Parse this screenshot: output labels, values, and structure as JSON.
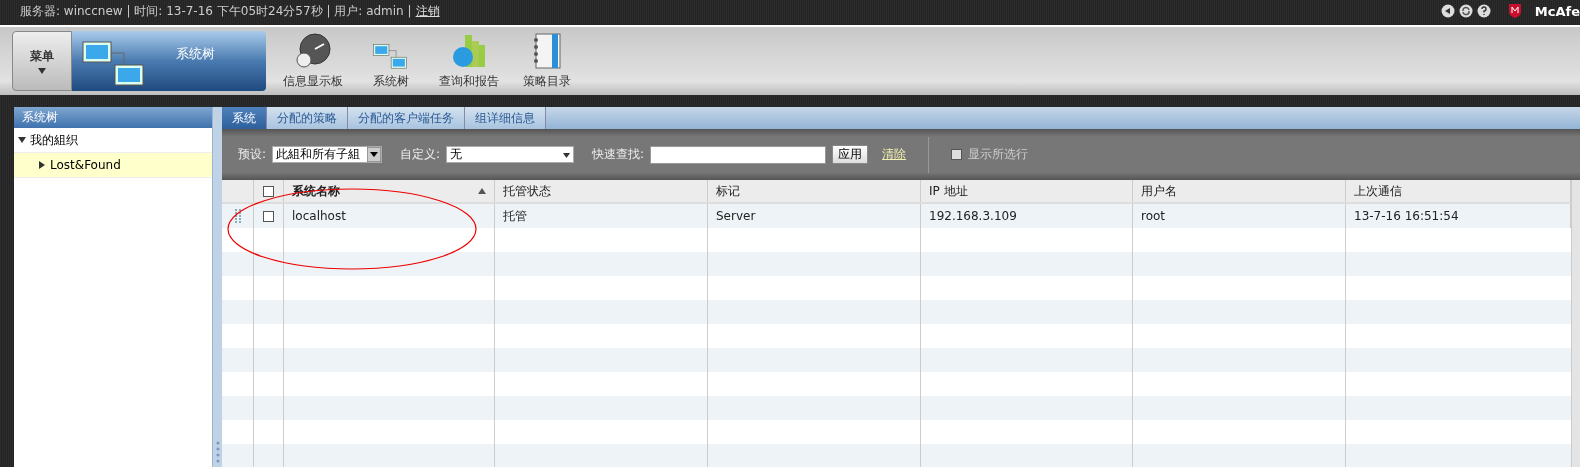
{
  "top_bar": {
    "server_label": "服务器: winccnew | 时间: 13-7-16 下午05时24分57秒 | 用户: admin |",
    "logout_link": "注销",
    "brand": "McAfe"
  },
  "menu_button": {
    "label": "菜单"
  },
  "current_section": {
    "label": "系统树"
  },
  "toolbar": [
    {
      "kind": "gauge",
      "label": "信息显示板"
    },
    {
      "kind": "tree",
      "label": "系统树"
    },
    {
      "kind": "chart",
      "label": "查询和报告"
    },
    {
      "kind": "notebook",
      "label": "策略目录"
    }
  ],
  "sidebar": {
    "title": "系统树",
    "items": [
      {
        "label": "我的組织",
        "expanded": true,
        "selected": false,
        "children": [
          {
            "label": "Lost&Found",
            "expanded": false,
            "selected": true
          }
        ]
      }
    ]
  },
  "tabs": [
    {
      "label": "系统",
      "selected": true
    },
    {
      "label": "分配的策略",
      "selected": false
    },
    {
      "label": "分配的客户端任务",
      "selected": false
    },
    {
      "label": "组详细信息",
      "selected": false
    }
  ],
  "filters": {
    "preset_label": "预设:",
    "preset_value": "此組和所有子組",
    "custom_label": "自定义:",
    "custom_value": "无",
    "search_label": "快速查找:",
    "apply_button": "应用",
    "clear_link": "清除",
    "show_selected": {
      "label": "显示所选行",
      "checked": false,
      "disabled": true
    }
  },
  "table": {
    "all_checked": false,
    "columns": [
      {
        "label": "系统名称",
        "sorted": true
      },
      {
        "label": "托管状态",
        "sorted": false
      },
      {
        "label": "标记",
        "sorted": false
      },
      {
        "label": "IP 地址",
        "sorted": false
      },
      {
        "label": "用户名",
        "sorted": false
      },
      {
        "label": "上次通信",
        "sorted": false
      }
    ],
    "rows": [
      {
        "checked": false,
        "cells": [
          "localhost",
          "托管",
          "Server",
          "192.168.3.109",
          "root",
          "13-7-16 16:51:54"
        ]
      }
    ]
  }
}
